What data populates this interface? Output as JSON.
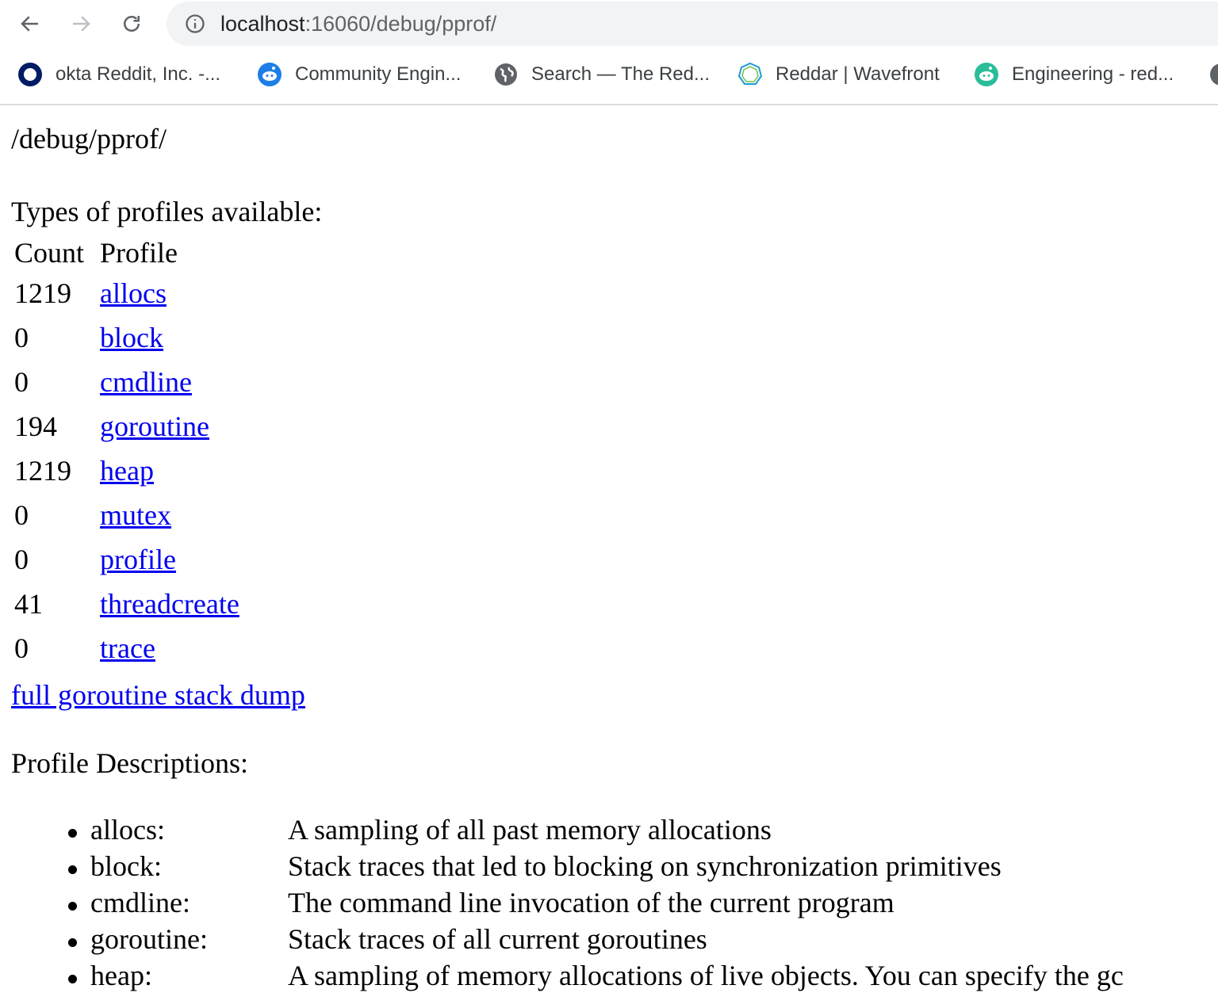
{
  "browser": {
    "url_host": "localhost",
    "url_rest": ":16060/debug/pprof/",
    "bookmarks": [
      {
        "label": "okta Reddit, Inc. -...",
        "icon": "okta-icon"
      },
      {
        "label": "Community Engin...",
        "icon": "reddit-icon"
      },
      {
        "label": "Search — The Red...",
        "icon": "globe-icon"
      },
      {
        "label": "Reddar | Wavefront",
        "icon": "wavefront-icon"
      },
      {
        "label": "Engineering - red...",
        "icon": "reddit-green-icon"
      }
    ]
  },
  "page": {
    "title": "/debug/pprof/",
    "types_heading": "Types of profiles available:",
    "table_headers": {
      "count": "Count",
      "profile": "Profile"
    },
    "profiles": [
      {
        "count": "1219",
        "name": "allocs"
      },
      {
        "count": "0",
        "name": "block"
      },
      {
        "count": "0",
        "name": "cmdline"
      },
      {
        "count": "194",
        "name": "goroutine"
      },
      {
        "count": "1219",
        "name": "heap"
      },
      {
        "count": "0",
        "name": "mutex"
      },
      {
        "count": "0",
        "name": "profile"
      },
      {
        "count": "41",
        "name": "threadcreate"
      },
      {
        "count": "0",
        "name": "trace"
      }
    ],
    "full_dump_link": "full goroutine stack dump",
    "descriptions_heading": "Profile Descriptions:",
    "descriptions": [
      {
        "name": "allocs:",
        "text": "A sampling of all past memory allocations"
      },
      {
        "name": "block:",
        "text": "Stack traces that led to blocking on synchronization primitives"
      },
      {
        "name": "cmdline:",
        "text": "The command line invocation of the current program"
      },
      {
        "name": "goroutine:",
        "text": "Stack traces of all current goroutines"
      },
      {
        "name": "heap:",
        "text": "A sampling of memory allocations of live objects. You can specify the gc"
      }
    ]
  },
  "colors": {
    "link": "#0000ee",
    "omnibox": "#f1f3f4"
  }
}
